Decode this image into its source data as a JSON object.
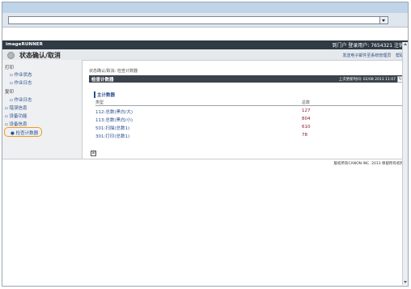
{
  "app": {
    "brand": "imageRUNNER",
    "logout_label": "到门户",
    "user_prefix": "登录用户:",
    "user_id": "7654321",
    "logout_action": "注销"
  },
  "title_bar": {
    "title": "状态确认/取消",
    "links": [
      "发送电子邮件至系统管理员",
      "帮助"
    ]
  },
  "sidebar": {
    "print_group": "打印",
    "print_items": [
      "作业状态",
      "作业日志"
    ],
    "copy_group": "复印",
    "copy_items": [
      "作业日志"
    ],
    "links": [
      "错误信息",
      "设备功能",
      "设备信息"
    ],
    "selected": "检查计数器"
  },
  "content": {
    "breadcrumb": "状态确认/取消: 检查计数器",
    "section_title": "检查计数器",
    "update_info": "上次更新时间: 02/08 2013 11:07",
    "panel_title": "主计数器",
    "table_headers": {
      "type": "类型",
      "total": "总数"
    },
    "rows": [
      {
        "type": "112:总数(黑白/大)",
        "total": "127"
      },
      {
        "type": "113:总数(黑白/小)",
        "total": "804"
      },
      {
        "type": "501:扫描(总数1)",
        "total": "610"
      },
      {
        "type": "301:打印(总数1)",
        "total": "78"
      }
    ]
  },
  "footer": {
    "copyright": "版权所有CANON INC. 2013 保留所有权利"
  },
  "colors": {
    "header_bg": "#2f3a44",
    "accent_orange": "#f29b1d",
    "link_blue": "#2c4f8c",
    "value_red": "#8a1a2e"
  }
}
